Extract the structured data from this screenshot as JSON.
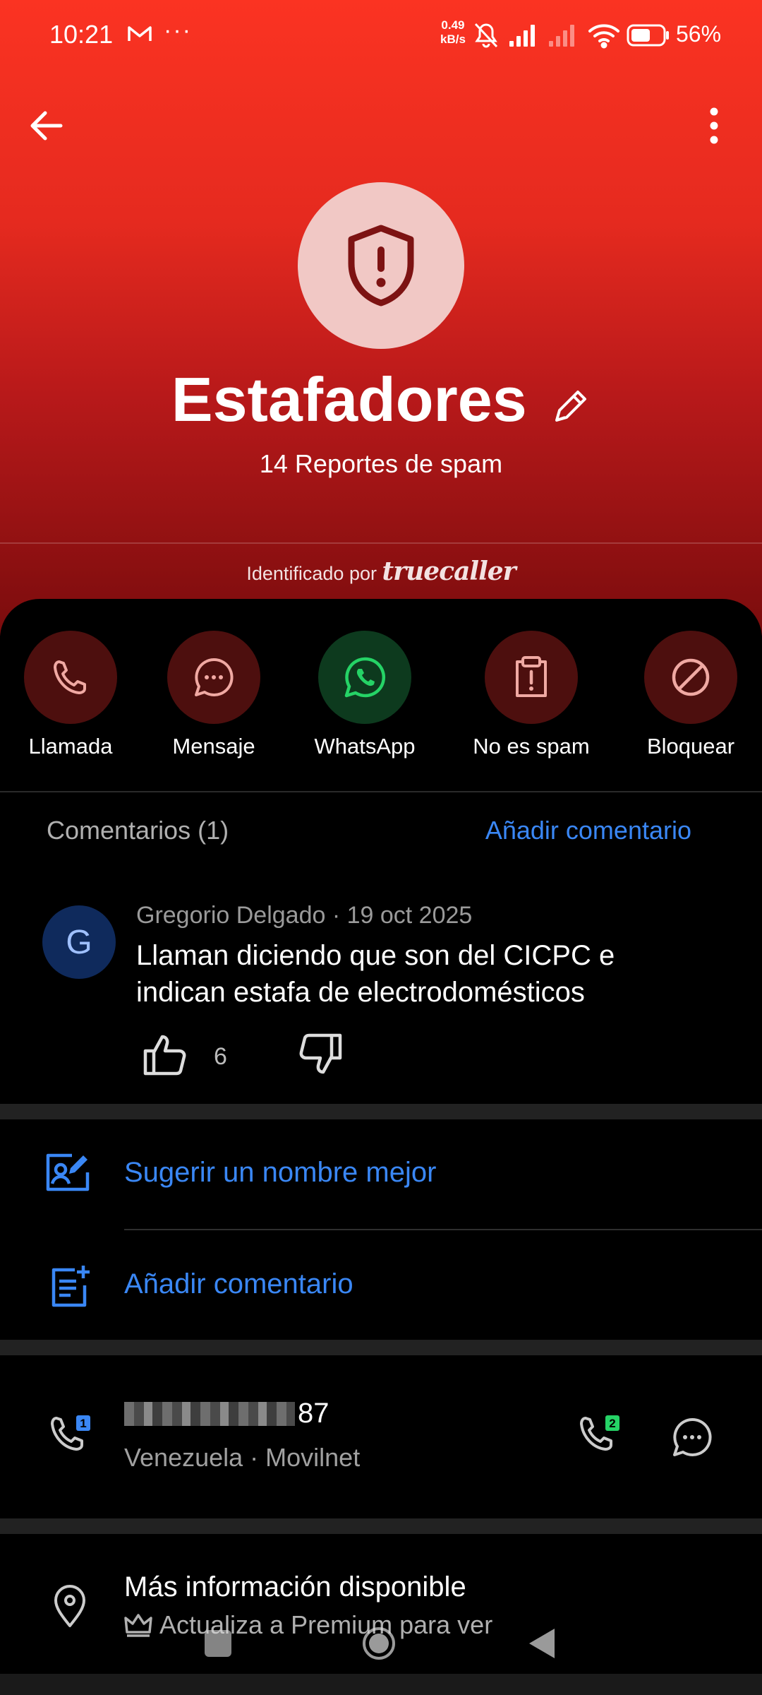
{
  "status_bar": {
    "time": "10:21",
    "net_speed_value": "0.49",
    "net_speed_unit": "kB/s",
    "battery": "56%"
  },
  "header": {
    "name": "Estafadores",
    "spam_reports": "14 Reportes de spam",
    "identified_prefix": "Identificado por",
    "brand": "truecaller"
  },
  "actions": [
    {
      "label": "Llamada",
      "icon": "phone-icon"
    },
    {
      "label": "Mensaje",
      "icon": "message-icon"
    },
    {
      "label": "WhatsApp",
      "icon": "whatsapp-icon"
    },
    {
      "label": "No es spam",
      "icon": "report-icon"
    },
    {
      "label": "Bloquear",
      "icon": "block-icon"
    }
  ],
  "comments": {
    "header": "Comentarios (1)",
    "add_link": "Añadir comentario",
    "items": [
      {
        "initial": "G",
        "meta": "Gregorio Delgado · 19 oct 2025",
        "text": "Llaman diciendo que son del CICPC e indican estafa de electrodomésticos",
        "likes": "6"
      }
    ]
  },
  "options": {
    "suggest_name": "Sugerir un nombre mejor",
    "add_comment": "Añadir comentario"
  },
  "number": {
    "suffix": "87",
    "subtitle": "Venezuela · Movilnet",
    "sim1": "1",
    "sim2": "2"
  },
  "more_info": {
    "title": "Más información disponible",
    "subtitle": "Actualiza a Premium para ver"
  },
  "colors": {
    "accent_blue": "#3a87f5",
    "hero_red": "#e52a1f",
    "whatsapp_green": "#25d366"
  }
}
